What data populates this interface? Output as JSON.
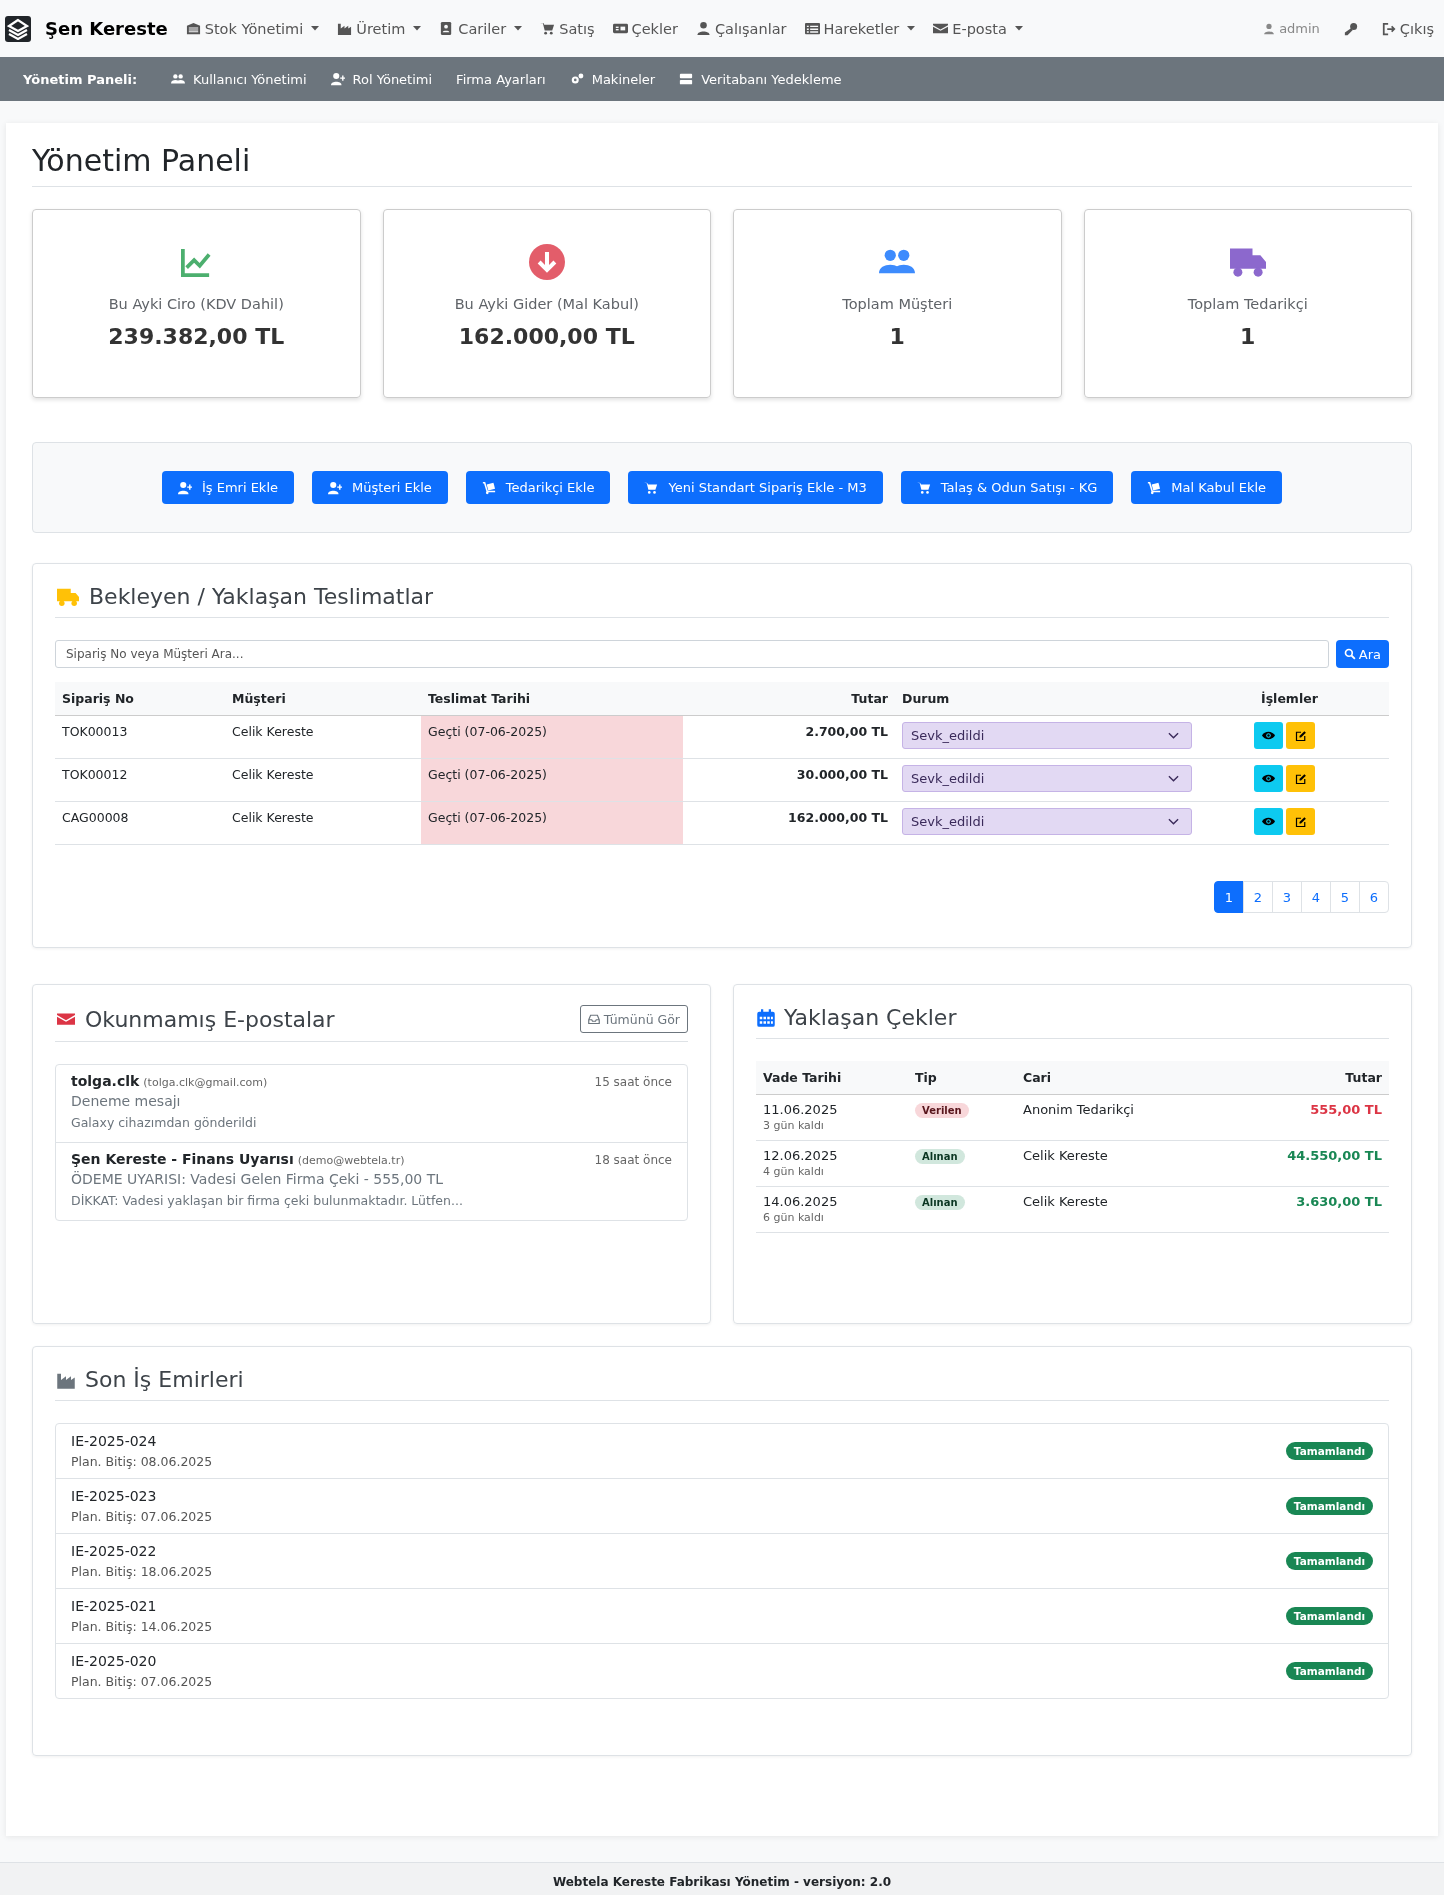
{
  "navbar": {
    "brand": "Şen Kereste",
    "items": [
      {
        "label": "Stok Yönetimi",
        "dropdown": true
      },
      {
        "label": "Üretim",
        "dropdown": true
      },
      {
        "label": "Cariler",
        "dropdown": true
      },
      {
        "label": "Satış",
        "dropdown": false
      },
      {
        "label": "Çekler",
        "dropdown": false
      },
      {
        "label": "Çalışanlar",
        "dropdown": false
      },
      {
        "label": "Hareketler",
        "dropdown": true
      },
      {
        "label": "E-posta",
        "dropdown": true
      }
    ],
    "user": "admin",
    "logout": "Çıkış"
  },
  "subnav": {
    "label": "Yönetim Paneli:",
    "items": [
      "Kullanıcı Yönetimi",
      "Rol Yönetimi",
      "Firma Ayarları",
      "Makineler",
      "Veritabanı Yedekleme"
    ]
  },
  "page_title": "Yönetim Paneli",
  "stats": [
    {
      "label": "Bu Ayki Ciro (KDV Dahil)",
      "value": "239.382,00 TL",
      "color": "#4caf6e"
    },
    {
      "label": "Bu Ayki Gider (Mal Kabul)",
      "value": "162.000,00 TL",
      "color": "#e35d6a"
    },
    {
      "label": "Toplam Müşteri",
      "value": "1",
      "color": "#3d8bfd"
    },
    {
      "label": "Toplam Tedarikçi",
      "value": "1",
      "color": "#8c68cd"
    }
  ],
  "quick_actions": [
    "İş Emri Ekle",
    "Müşteri Ekle",
    "Tedarikçi Ekle",
    "Yeni Standart Sipariş Ekle - M3",
    "Talaş & Odun Satışı - KG",
    "Mal Kabul Ekle"
  ],
  "deliveries": {
    "title": "Bekleyen / Yaklaşan Teslimatlar",
    "search": {
      "placeholder": "Sipariş No veya Müşteri Ara..."
    },
    "search_button": "Ara",
    "columns": [
      "Sipariş No",
      "Müşteri",
      "Teslimat Tarihi",
      "Tutar",
      "Durum",
      "İşlemler"
    ],
    "rows": [
      {
        "order_no": "TOK00013",
        "customer": "Celik Kereste",
        "delivery_date": "Geçti (07-06-2025)",
        "overdue": true,
        "amount": "2.700,00 TL",
        "status": "Sevk_edildi"
      },
      {
        "order_no": "TOK00012",
        "customer": "Celik Kereste",
        "delivery_date": "Geçti (07-06-2025)",
        "overdue": true,
        "amount": "30.000,00 TL",
        "status": "Sevk_edildi"
      },
      {
        "order_no": "CAG00008",
        "customer": "Celik Kereste",
        "delivery_date": "Geçti (07-06-2025)",
        "overdue": true,
        "amount": "162.000,00 TL",
        "status": "Sevk_edildi"
      }
    ],
    "pagination": [
      {
        "label": "1",
        "selected": true
      },
      {
        "label": "2",
        "selected": false
      },
      {
        "label": "3",
        "selected": false
      },
      {
        "label": "4",
        "selected": false
      },
      {
        "label": "5",
        "selected": false
      },
      {
        "label": "6",
        "selected": false
      }
    ]
  },
  "emails": {
    "title": "Okunmamış E-postalar",
    "view_all": "Tümünü Gör",
    "items": [
      {
        "sender": "tolga.clk",
        "address": "(tolga.clk@gmail.com)",
        "time": "15 saat önce",
        "subject": "Deneme mesajı",
        "preview": "Galaxy cihazımdan gönderildi"
      },
      {
        "sender": "Şen Kereste - Finans Uyarısı",
        "address": "(demo@webtela.tr)",
        "time": "18 saat önce",
        "subject": "ÖDEME UYARISI: Vadesi Gelen Firma Çeki - 555,00 TL",
        "preview": "DİKKAT: Vadesi yaklaşan bir firma çeki bulunmaktadır. Lütfen..."
      }
    ]
  },
  "checks": {
    "title": "Yaklaşan Çekler",
    "columns": [
      "Vade Tarihi",
      "Tip",
      "Cari",
      "Tutar"
    ],
    "rows": [
      {
        "due_date": "11.06.2025",
        "remaining": "3 gün kaldı",
        "type": "Verilen",
        "kind": "given",
        "party": "Anonim Tedarikçi",
        "amount": "555,00 TL"
      },
      {
        "due_date": "12.06.2025",
        "remaining": "4 gün kaldı",
        "type": "Alınan",
        "kind": "received",
        "party": "Celik Kereste",
        "amount": "44.550,00 TL"
      },
      {
        "due_date": "14.06.2025",
        "remaining": "6 gün kaldı",
        "type": "Alınan",
        "kind": "received",
        "party": "Celik Kereste",
        "amount": "3.630,00 TL"
      }
    ]
  },
  "work_orders": {
    "title": "Son İş Emirleri",
    "items": [
      {
        "code": "IE-2025-024",
        "plan_end": "Plan. Bitiş: 08.06.2025",
        "status": "Tamamlandı"
      },
      {
        "code": "IE-2025-023",
        "plan_end": "Plan. Bitiş: 07.06.2025",
        "status": "Tamamlandı"
      },
      {
        "code": "IE-2025-022",
        "plan_end": "Plan. Bitiş: 18.06.2025",
        "status": "Tamamlandı"
      },
      {
        "code": "IE-2025-021",
        "plan_end": "Plan. Bitiş: 14.06.2025",
        "status": "Tamamlandı"
      },
      {
        "code": "IE-2025-020",
        "plan_end": "Plan. Bitiş: 07.06.2025",
        "status": "Tamamlandı"
      }
    ]
  },
  "footer": "Webtela Kereste Fabrikası Yönetim - versiyon: 2.0"
}
